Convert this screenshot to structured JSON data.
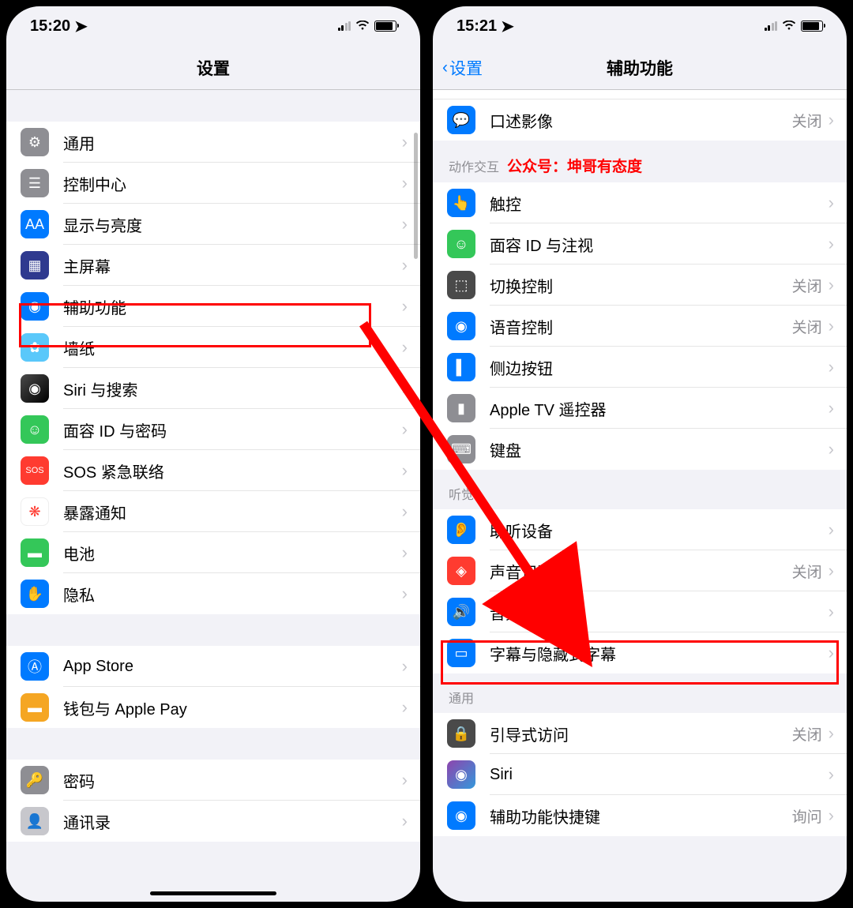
{
  "left": {
    "status": {
      "time": "15:20",
      "location_icon": "↗"
    },
    "nav": {
      "title": "设置"
    },
    "rows": [
      {
        "id": "general",
        "label": "通用",
        "icon": "ic-gear",
        "glyph": "⚙"
      },
      {
        "id": "control",
        "label": "控制中心",
        "icon": "ic-control",
        "glyph": "☰"
      },
      {
        "id": "display",
        "label": "显示与亮度",
        "icon": "ic-aa",
        "glyph": "AA"
      },
      {
        "id": "home",
        "label": "主屏幕",
        "icon": "ic-home",
        "glyph": "▦"
      },
      {
        "id": "access",
        "label": "辅助功能",
        "icon": "ic-access",
        "glyph": "◉"
      },
      {
        "id": "wallpaper",
        "label": "墙纸",
        "icon": "ic-wall",
        "glyph": "✿"
      },
      {
        "id": "siri",
        "label": "Siri 与搜索",
        "icon": "ic-siri",
        "glyph": "◉"
      },
      {
        "id": "faceid",
        "label": "面容 ID 与密码",
        "icon": "ic-face",
        "glyph": "☺"
      },
      {
        "id": "sos",
        "label": "SOS 紧急联络",
        "icon": "ic-sos",
        "glyph": "SOS"
      },
      {
        "id": "exposure",
        "label": "暴露通知",
        "icon": "ic-expose",
        "glyph": "❋"
      },
      {
        "id": "battery",
        "label": "电池",
        "icon": "ic-battery",
        "glyph": "▬"
      },
      {
        "id": "privacy",
        "label": "隐私",
        "icon": "ic-privacy",
        "glyph": "✋"
      }
    ],
    "rows2": [
      {
        "id": "appstore",
        "label": "App Store",
        "icon": "ic-appstore",
        "glyph": "Ⓐ"
      },
      {
        "id": "wallet",
        "label": "钱包与 Apple Pay",
        "icon": "ic-wallet",
        "glyph": "▬"
      }
    ],
    "rows3": [
      {
        "id": "passwords",
        "label": "密码",
        "icon": "ic-password",
        "glyph": "🔑"
      },
      {
        "id": "contacts",
        "label": "通讯录",
        "icon": "ic-contacts",
        "glyph": "👤"
      }
    ]
  },
  "right": {
    "status": {
      "time": "15:21",
      "location_icon": "↗"
    },
    "nav": {
      "back": "设置",
      "title": "辅助功能"
    },
    "rows0": [
      {
        "id": "audio-desc",
        "label": "口述影像",
        "icon": "ic-speech",
        "glyph": "💬",
        "value": "关闭"
      }
    ],
    "section1": {
      "label": "动作交互",
      "annotation": "公众号：坤哥有态度"
    },
    "rows1": [
      {
        "id": "touch",
        "label": "触控",
        "icon": "ic-touch",
        "glyph": "👆"
      },
      {
        "id": "face-attention",
        "label": "面容 ID 与注视",
        "icon": "ic-faceid",
        "glyph": "☺"
      },
      {
        "id": "switch-control",
        "label": "切换控制",
        "icon": "ic-switch",
        "glyph": "⬚",
        "value": "关闭"
      },
      {
        "id": "voice-control",
        "label": "语音控制",
        "icon": "ic-voice",
        "glyph": "◉",
        "value": "关闭"
      },
      {
        "id": "side-button",
        "label": "侧边按钮",
        "icon": "ic-side",
        "glyph": "▌"
      },
      {
        "id": "apple-tv",
        "label": "Apple TV 遥控器",
        "icon": "ic-tv",
        "glyph": "▮"
      },
      {
        "id": "keyboard",
        "label": "键盘",
        "icon": "ic-keyboard",
        "glyph": "⌨"
      }
    ],
    "section2": {
      "label": "听觉"
    },
    "rows2": [
      {
        "id": "hearing",
        "label": "助听设备",
        "icon": "ic-hearing",
        "glyph": "👂"
      },
      {
        "id": "sound-rec",
        "label": "声音识别",
        "icon": "ic-sound",
        "glyph": "◈",
        "value": "关闭"
      },
      {
        "id": "audio-visual",
        "label": "音频/视觉",
        "icon": "ic-audio",
        "glyph": "🔊"
      },
      {
        "id": "subtitles",
        "label": "字幕与隐藏式字幕",
        "icon": "ic-subtitle",
        "glyph": "▭"
      }
    ],
    "section3": {
      "label": "通用"
    },
    "rows3": [
      {
        "id": "guided",
        "label": "引导式访问",
        "icon": "ic-guided",
        "glyph": "🔒",
        "value": "关闭"
      },
      {
        "id": "siri",
        "label": "Siri",
        "icon": "ic-siri2",
        "glyph": "◉"
      },
      {
        "id": "shortcut",
        "label": "辅助功能快捷键",
        "icon": "ic-shortcut",
        "glyph": "◉",
        "value": "询问"
      }
    ]
  }
}
